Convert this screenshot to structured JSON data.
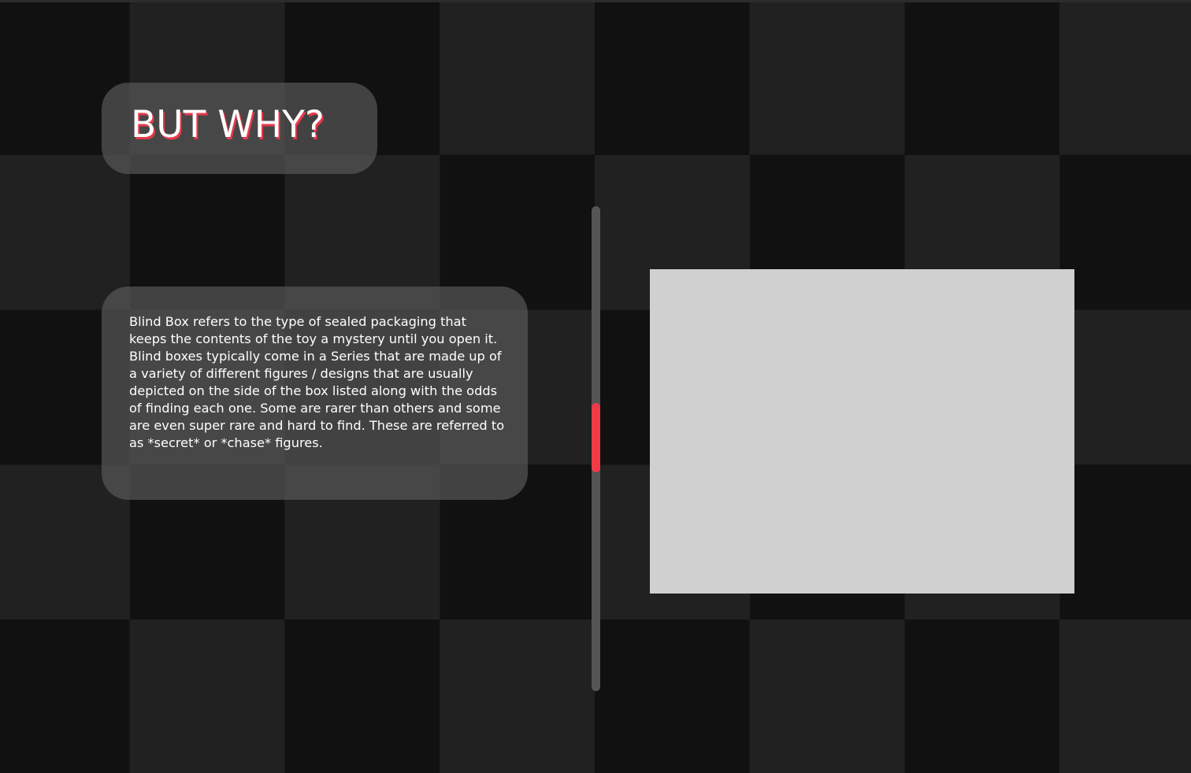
{
  "heading": {
    "title": "BUT WHY?"
  },
  "description": {
    "text": "Blind Box refers to the type of sealed packaging that keeps the contents of the toy a mystery until you open it. Blind boxes typically come in a Series that are made up of a variety of different figures / designs that are usually depicted on the side of the box listed along with the odds of finding each one. Some are rarer than others and some are even super rare and hard to find. These are referred to as *secret* or *chase* figures."
  },
  "colors": {
    "accent": "#f03a47",
    "card": "#4b4b4b",
    "background_dark": "#111111",
    "background_light": "#212121",
    "image_placeholder": "#d0d0d0"
  }
}
